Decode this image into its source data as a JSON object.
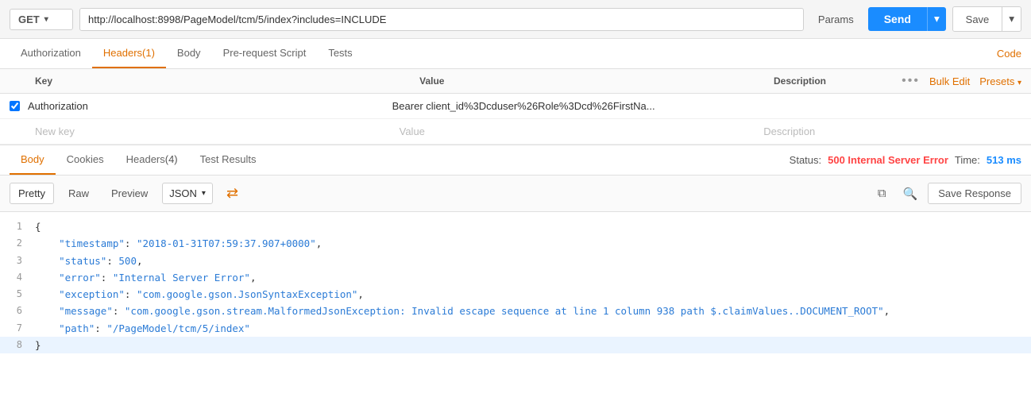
{
  "topbar": {
    "method": "GET",
    "method_chevron": "▾",
    "url": "http://localhost:8998/PageModel/tcm/5/index?includes=INCLUDE",
    "params_label": "Params",
    "send_label": "Send",
    "save_label": "Save"
  },
  "request_tabs": {
    "tabs": [
      {
        "id": "authorization",
        "label": "Authorization",
        "active": false,
        "count": null
      },
      {
        "id": "headers",
        "label": "Headers",
        "active": true,
        "count": "(1)"
      },
      {
        "id": "body",
        "label": "Body",
        "active": false,
        "count": null
      },
      {
        "id": "pre-request",
        "label": "Pre-request Script",
        "active": false,
        "count": null
      },
      {
        "id": "tests",
        "label": "Tests",
        "active": false,
        "count": null
      }
    ],
    "code_label": "Code"
  },
  "headers_table": {
    "col_key": "Key",
    "col_value": "Value",
    "col_description": "Description",
    "more_dots": "•••",
    "bulk_edit": "Bulk Edit",
    "presets": "Presets",
    "presets_chevron": "▾",
    "rows": [
      {
        "checked": true,
        "key": "Authorization",
        "value": "Bearer client_id%3Dcduser%26Role%3Dcd%26FirstNa...",
        "description": ""
      }
    ],
    "new_row": {
      "key_placeholder": "New key",
      "value_placeholder": "Value",
      "desc_placeholder": "Description"
    }
  },
  "response_tabs": {
    "tabs": [
      {
        "id": "body",
        "label": "Body",
        "active": true
      },
      {
        "id": "cookies",
        "label": "Cookies",
        "active": false
      },
      {
        "id": "headers",
        "label": "Headers",
        "count": "(4)",
        "active": false
      },
      {
        "id": "test-results",
        "label": "Test Results",
        "active": false
      }
    ],
    "status_label": "Status:",
    "status_code": "500 Internal Server Error",
    "time_label": "Time:",
    "time_value": "513 ms"
  },
  "response_toolbar": {
    "pretty_label": "Pretty",
    "raw_label": "Raw",
    "preview_label": "Preview",
    "format_label": "JSON",
    "format_chevron": "▾",
    "wrap_icon": "⇄",
    "save_response_label": "Save Response"
  },
  "response_body": {
    "lines": [
      {
        "num": 1,
        "content": "{",
        "highlight": false
      },
      {
        "num": 2,
        "content": "    \"timestamp\": \"2018-01-31T07:59:37.907+0000\",",
        "highlight": false
      },
      {
        "num": 3,
        "content": "    \"status\": 500,",
        "highlight": false
      },
      {
        "num": 4,
        "content": "    \"error\": \"Internal Server Error\",",
        "highlight": false
      },
      {
        "num": 5,
        "content": "    \"exception\": \"com.google.gson.JsonSyntaxException\",",
        "highlight": false
      },
      {
        "num": 6,
        "content": "    \"message\": \"com.google.gson.stream.MalformedJsonException: Invalid escape sequence at line 1 column 938 path $.claimValues..DOCUMENT_ROOT\",",
        "highlight": false
      },
      {
        "num": 7,
        "content": "    \"path\": \"/PageModel/tcm/5/index\"",
        "highlight": false
      },
      {
        "num": 8,
        "content": "}",
        "highlight": true
      }
    ]
  }
}
